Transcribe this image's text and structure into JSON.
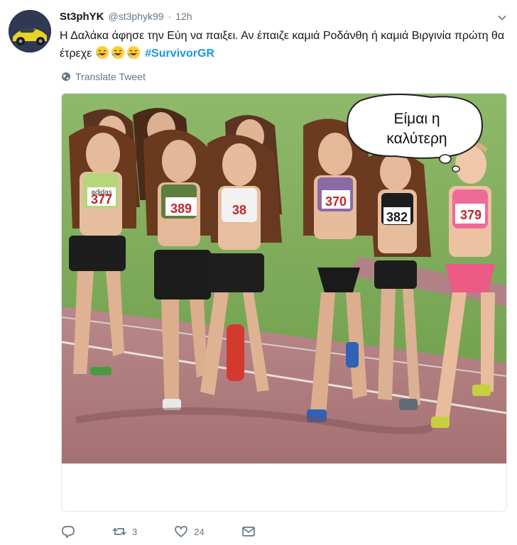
{
  "tweet": {
    "display_name": "St3phYK",
    "handle": "@st3phyk99",
    "separator": "·",
    "time": "12h",
    "text": "Η Δαλάκα άφησε την Εύη να παιξει. Αν έπαιζε καμιά Ροδάνθη ή καμιά Βιργινία πρώτη θα έτρεχε",
    "emojis": [
      "rofl-emoji",
      "rofl-emoji",
      "rofl-emoji"
    ],
    "hashtag": "#SurvivorGR",
    "translate_label": "Translate Tweet"
  },
  "media": {
    "speech_bubble_line1": "Είμαι η",
    "speech_bubble_line2": "καλύτερη",
    "bibs": [
      "377",
      "389",
      "38",
      "370",
      "382",
      "379"
    ],
    "bib_brand": "adidas"
  },
  "actions": {
    "reply_icon": "reply-icon",
    "retweet_icon": "retweet-icon",
    "retweet_count": "3",
    "like_icon": "heart-icon",
    "like_count": "24",
    "message_icon": "envelope-icon"
  },
  "colors": {
    "text": "#14171a",
    "secondary": "#657786",
    "link": "#1b95e0",
    "border": "#e1e8ed"
  }
}
